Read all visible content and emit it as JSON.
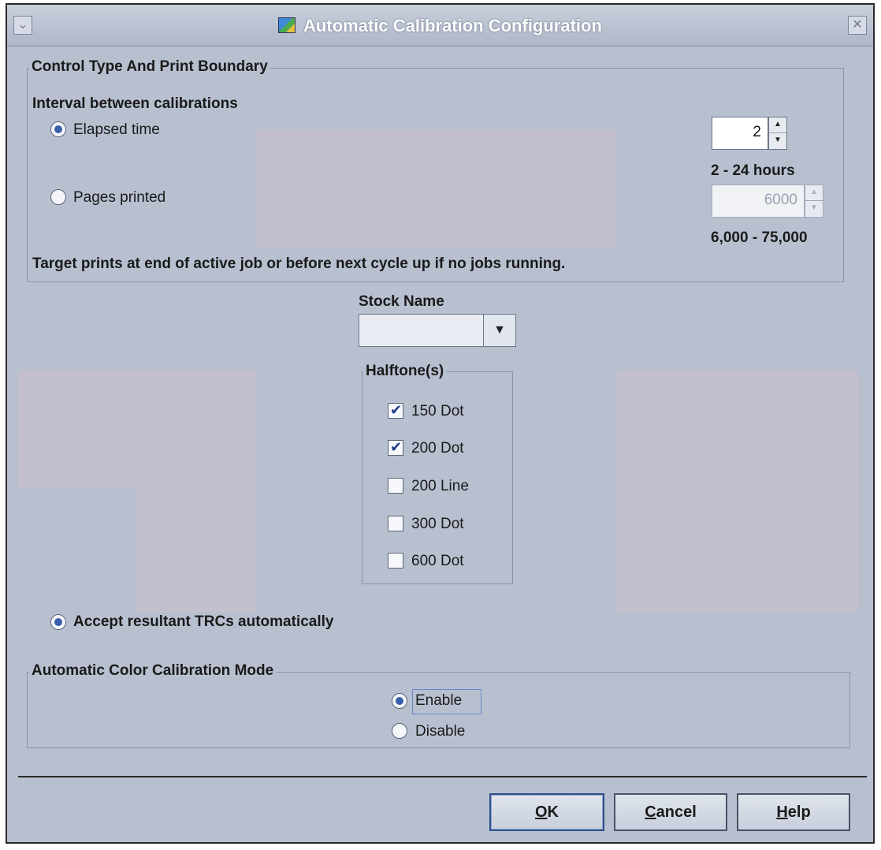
{
  "window": {
    "title": "Automatic Calibration Configuration",
    "minimize_icon": "chevron-down-icon",
    "close_icon": "close-icon"
  },
  "control_panel": {
    "legend": "Control Type And Print Boundary",
    "interval_label": "Interval between calibrations",
    "elapsed_time": {
      "label": "Elapsed time",
      "selected": true
    },
    "pages_printed": {
      "label": "Pages printed",
      "selected": false
    },
    "hours_spinner": {
      "value": "2",
      "range_label": "2 - 24 hours"
    },
    "pages_spinner": {
      "value": "6000",
      "range_label": "6,000 - 75,000",
      "enabled": false
    },
    "note": "Target prints at end of active job or before next cycle up if no jobs running."
  },
  "stock": {
    "label": "Stock Name",
    "selected_value": ""
  },
  "halftones": {
    "legend": "Halftone(s)",
    "items": [
      {
        "label": "150 Dot",
        "checked": true
      },
      {
        "label": "200 Dot",
        "checked": true
      },
      {
        "label": "200 Line",
        "checked": false
      },
      {
        "label": "300 Dot",
        "checked": false
      },
      {
        "label": "600 Dot",
        "checked": false
      }
    ]
  },
  "accept_trcs": {
    "label": "Accept resultant TRCs automatically",
    "selected": true
  },
  "color_mode": {
    "legend": "Automatic Color Calibration Mode",
    "enable": {
      "label": "Enable",
      "selected": true
    },
    "disable": {
      "label": "Disable",
      "selected": false
    }
  },
  "buttons": {
    "ok": {
      "mnemonic": "O",
      "rest": "K"
    },
    "cancel": {
      "mnemonic": "C",
      "rest": "ancel"
    },
    "help": {
      "mnemonic": "H",
      "rest": "elp"
    }
  }
}
